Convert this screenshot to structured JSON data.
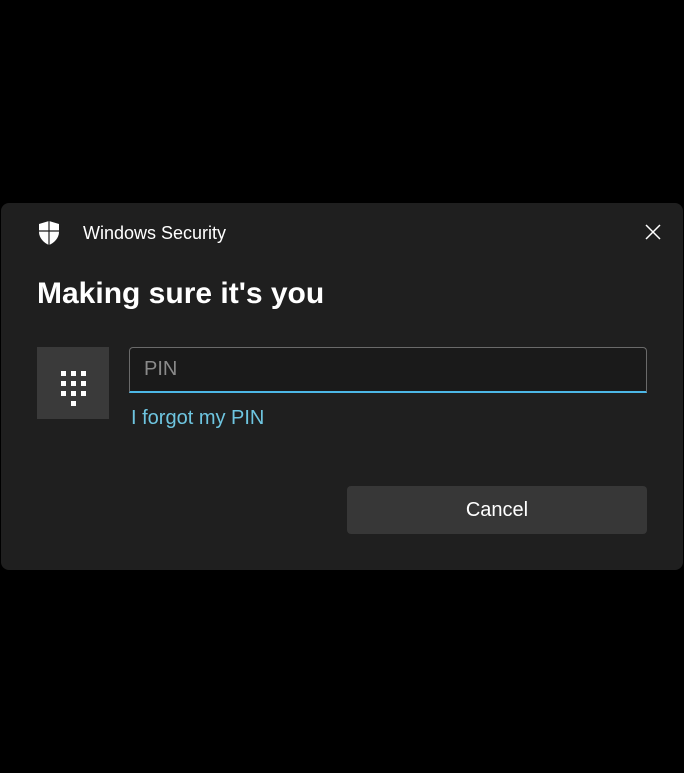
{
  "header": {
    "title": "Windows Security"
  },
  "dialog": {
    "heading": "Making sure it's you"
  },
  "pin": {
    "placeholder": "PIN",
    "value": "",
    "forgot_link": "I forgot my PIN"
  },
  "actions": {
    "cancel": "Cancel"
  },
  "icons": {
    "shield": "shield-icon",
    "close": "close-icon",
    "keypad": "keypad-icon"
  }
}
